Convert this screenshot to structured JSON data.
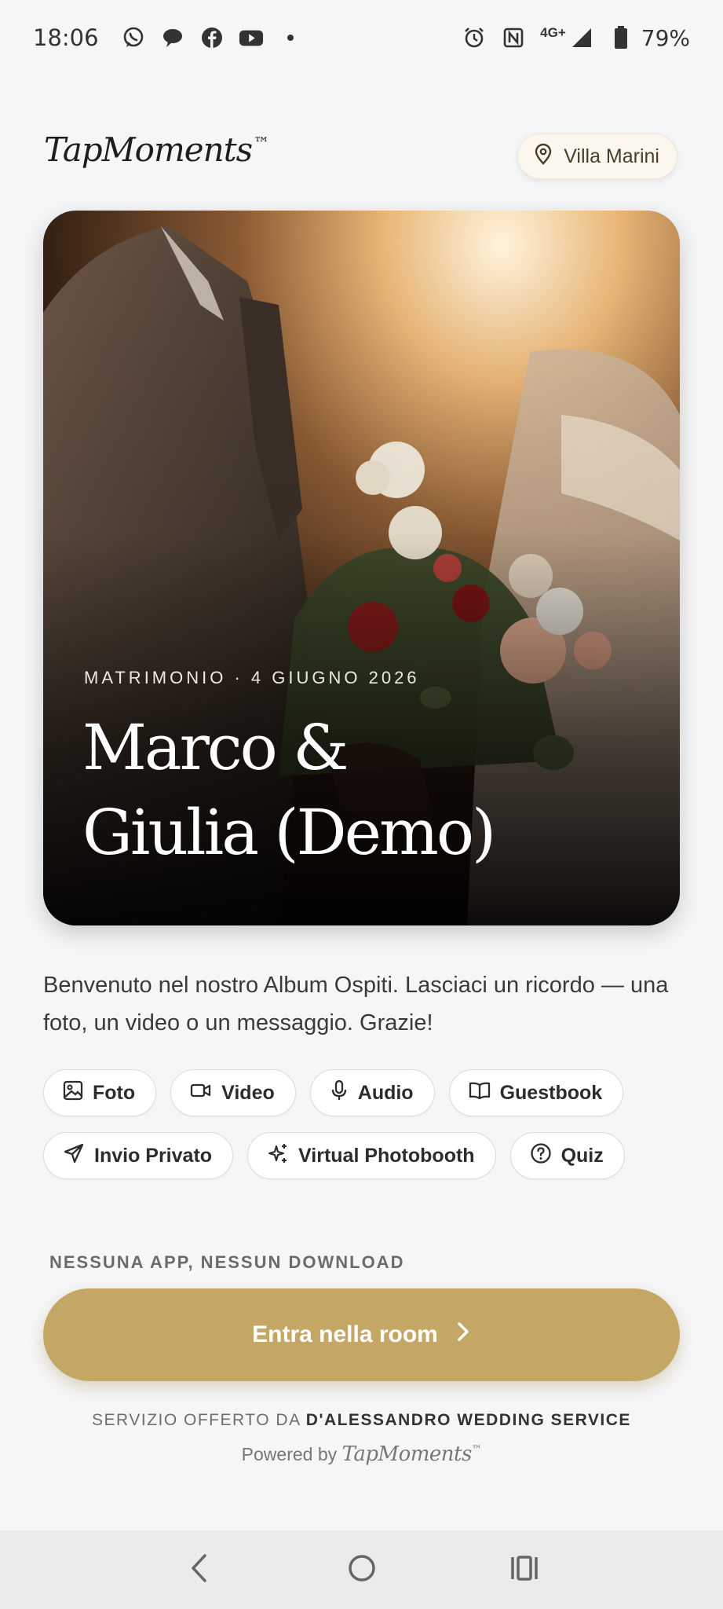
{
  "status_bar": {
    "time": "18:06",
    "network": "4G+",
    "battery": "79%",
    "left_icons": [
      "whatsapp-icon",
      "chat-icon",
      "facebook-icon",
      "youtube-icon",
      "dot-icon"
    ],
    "right_icons": [
      "alarm-icon",
      "nfc-icon",
      "signal-icon",
      "battery-icon"
    ]
  },
  "header": {
    "brand": "TapMoments",
    "brand_mark": "™",
    "location": "Villa Marini"
  },
  "hero": {
    "tag": "MATRIMONIO · 4 GIUGNO 2026",
    "title_line1": "Marco &",
    "title_line2": "Giulia (Demo)"
  },
  "intro": "Benvenuto nel nostro Album Ospiti. Lasciaci un ricordo — una foto, un video o un messaggio. Grazie!",
  "chips": [
    {
      "label": "Foto",
      "icon": "image-icon"
    },
    {
      "label": "Video",
      "icon": "video-icon"
    },
    {
      "label": "Audio",
      "icon": "mic-icon"
    },
    {
      "label": "Guestbook",
      "icon": "book-icon"
    },
    {
      "label": "Invio Privato",
      "icon": "send-icon"
    },
    {
      "label": "Virtual Photobooth",
      "icon": "sparkles-icon"
    },
    {
      "label": "Quiz",
      "icon": "help-circle-icon"
    }
  ],
  "cta": {
    "kicker": "NESSUNA APP, NESSUN DOWNLOAD",
    "label": "Entra nella room"
  },
  "footer": {
    "service_prefix": "SERVIZIO OFFERTO DA",
    "service_name": "D'ALESSANDRO WEDDING SERVICE",
    "powered_prefix": "Powered by",
    "powered_brand": "TapMoments",
    "powered_mark": "™"
  },
  "colors": {
    "accent": "#c4a765",
    "background": "#f5f6f8",
    "pill_bg": "#fbf7ee"
  }
}
